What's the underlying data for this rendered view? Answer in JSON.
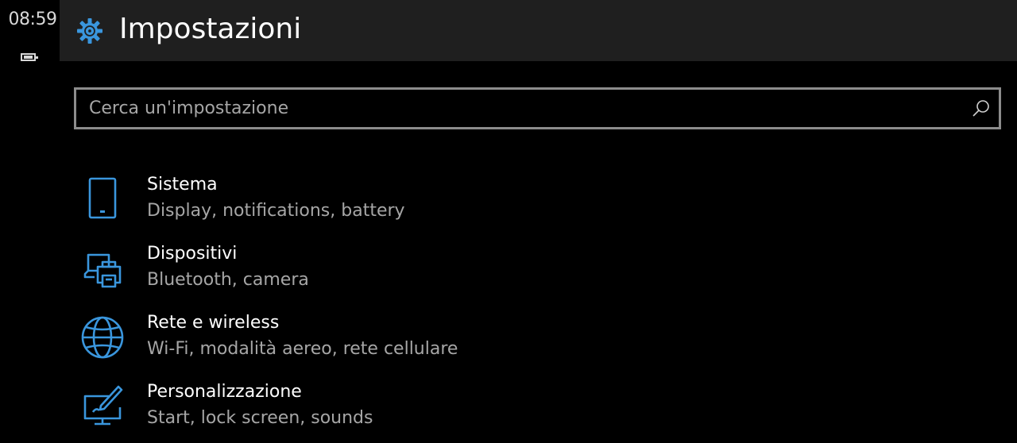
{
  "status": {
    "time": "08:59",
    "battery_icon": "battery-icon"
  },
  "header": {
    "title": "Impostazioni",
    "icon": "gear-icon",
    "accent": "#3a96dd"
  },
  "search": {
    "placeholder": "Cerca un'impostazione",
    "icon": "search-icon"
  },
  "categories": [
    {
      "title": "Sistema",
      "subtitle": "Display, notifications, battery",
      "icon": "phone-icon"
    },
    {
      "title": "Dispositivi",
      "subtitle": "Bluetooth, camera",
      "icon": "devices-icon"
    },
    {
      "title": "Rete e wireless",
      "subtitle": "Wi-Fi, modalità aereo, rete cellulare",
      "icon": "globe-icon"
    },
    {
      "title": "Personalizzazione",
      "subtitle": "Start, lock screen, sounds",
      "icon": "personalization-icon"
    }
  ]
}
